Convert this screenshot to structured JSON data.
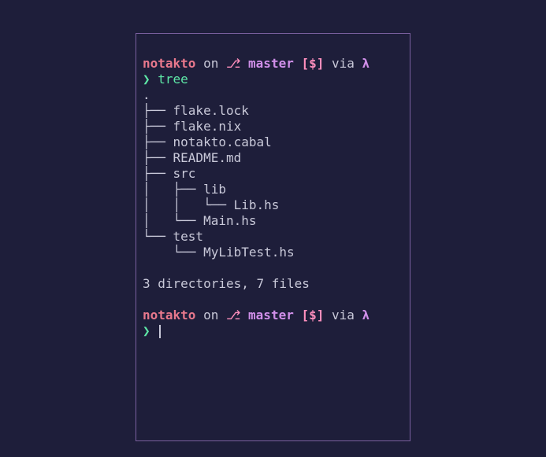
{
  "prompt1": {
    "dir": "notakto",
    "on": " on ",
    "branch_icon": "⎇",
    "branch": " master ",
    "stash": "[$]",
    "via": " via ",
    "lambda": "λ",
    "symbol": "❯ ",
    "command": "tree"
  },
  "tree": {
    "lines": [
      ".",
      "├── flake.lock",
      "├── flake.nix",
      "├── notakto.cabal",
      "├── README.md",
      "├── src",
      "│   ├── lib",
      "│   │   └── Lib.hs",
      "│   └── Main.hs",
      "└── test",
      "    └── MyLibTest.hs"
    ],
    "summary": "3 directories, 7 files"
  },
  "prompt2": {
    "dir": "notakto",
    "on": " on ",
    "branch_icon": "⎇",
    "branch": " master ",
    "stash": "[$]",
    "via": " via ",
    "lambda": "λ",
    "symbol": "❯ "
  }
}
